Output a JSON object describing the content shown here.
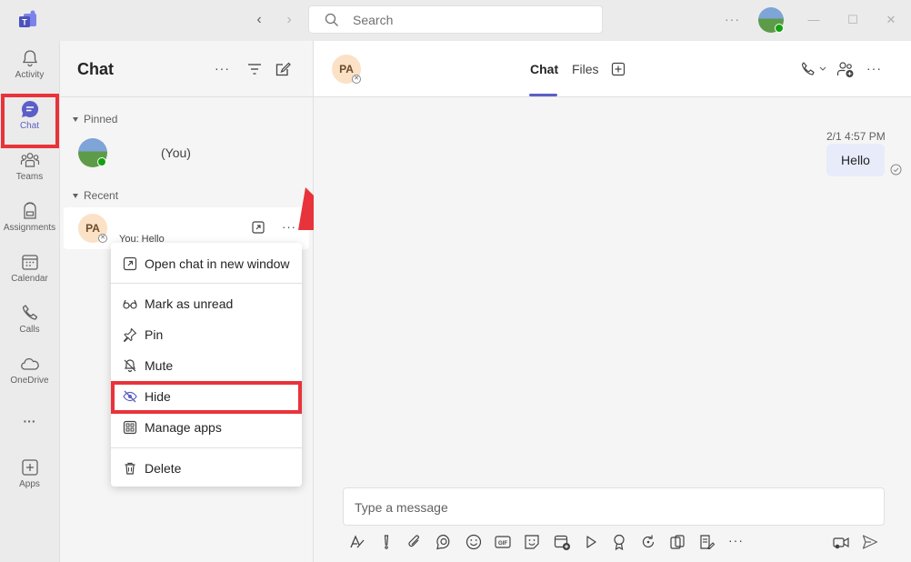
{
  "titlebar": {
    "search_placeholder": "Search",
    "more_label": "···",
    "back_label": "‹",
    "forward_label": "›",
    "minimize_label": "—",
    "maximize_label": "☐",
    "close_label": "✕"
  },
  "rail": {
    "items": [
      {
        "label": "Activity"
      },
      {
        "label": "Chat"
      },
      {
        "label": "Teams"
      },
      {
        "label": "Assignments"
      },
      {
        "label": "Calendar"
      },
      {
        "label": "Calls"
      },
      {
        "label": "OneDrive"
      },
      {
        "label": "···"
      },
      {
        "label": "Apps"
      }
    ]
  },
  "chatlist": {
    "title": "Chat",
    "pinned_label": "Pinned",
    "pinned_name": "(You)",
    "recent_label": "Recent",
    "recent_initials": "PA",
    "recent_preview": "You: Hello",
    "row_more": "···",
    "header_more": "···"
  },
  "context_menu": {
    "items": [
      {
        "label": "Open chat in new window"
      },
      {
        "label": "Mark as unread"
      },
      {
        "label": "Pin"
      },
      {
        "label": "Mute"
      },
      {
        "label": "Hide"
      },
      {
        "label": "Manage apps"
      },
      {
        "label": "Delete"
      }
    ]
  },
  "main": {
    "avatar_initials": "PA",
    "tabs": [
      {
        "label": "Chat"
      },
      {
        "label": "Files"
      }
    ],
    "header_more": "···",
    "message": {
      "time": "2/1 4:57 PM",
      "text": "Hello"
    },
    "compose_placeholder": "Type a message",
    "toolbar_more": "···"
  },
  "colors": {
    "accent": "#5b5fc7",
    "highlight": "#e8333a",
    "presence_available": "#13a10e"
  }
}
